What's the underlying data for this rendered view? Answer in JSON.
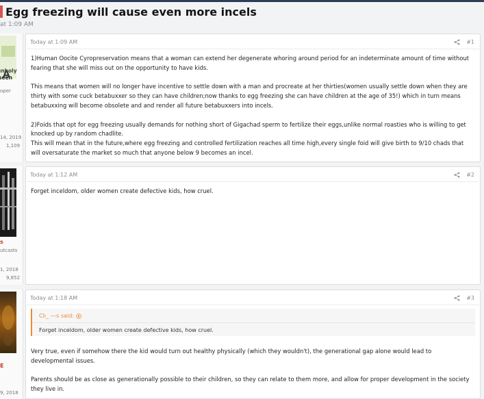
{
  "thread": {
    "title": "Egg freezing will cause even more incels",
    "meta": "at 1:09 AM"
  },
  "posts": [
    {
      "time": "Today at 1:09 AM",
      "num": "#1",
      "sidebar": {
        "name": "unholy",
        "title": "seen",
        "sub": "oper",
        "joined": "14, 2019",
        "count": "1,109"
      },
      "paragraphs": [
        "1)Human Oocite Cyropreservation means that a woman can extend her degenerate whoring around period for an indeterminate amount of time without fearing that she will miss out on the opportunity to have kids.",
        "This means that women will no longer have incentive to settle down with a man and procreate at her thirties(women usually settle down when they are thirty with some cuck betabuxxer so they can have children;now thanks to egg freezing she can have children at the age of 35!) which in turn means betabuxxing will become obsolete and and render all future betabuxxers into incels.",
        "2)Foids that opt for egg freezing usually demands for nothing short of Gigachad sperm to fertilize their eggs,unlike normal roasties who is willing to get knocked up by random chadlite.\nThis will mean that in the future,where egg freezing and controlled fertilization reaches all time high,every single foid will give birth to 9/10 chads that will oversaturate the market so much that anyone below 9 becomes an incel."
      ]
    },
    {
      "time": "Today at 1:12 AM",
      "num": "#2",
      "sidebar": {
        "name": "s",
        "title": "utcasts",
        "joined": "1, 2018",
        "count": "9,852"
      },
      "paragraphs": [
        "Forget inceldom, older women create defective kids, how cruel."
      ]
    },
    {
      "time": "Today at 1:18 AM",
      "num": "#3",
      "sidebar": {
        "name": "E",
        "joined": "9, 2018"
      },
      "quote": {
        "author": "Clı_ ‐‐‐s said:",
        "text": "Forget inceldom, older women create defective kids, how cruel."
      },
      "paragraphs": [
        "Very true, even if somehow there the kid would turn out healthy physically (which they wouldn't), the generational gap alone would lead to developmental issues.",
        "Parents should be as close as generationally possible to their children, so they can relate to them more, and allow for proper development in the society they live in."
      ]
    }
  ]
}
